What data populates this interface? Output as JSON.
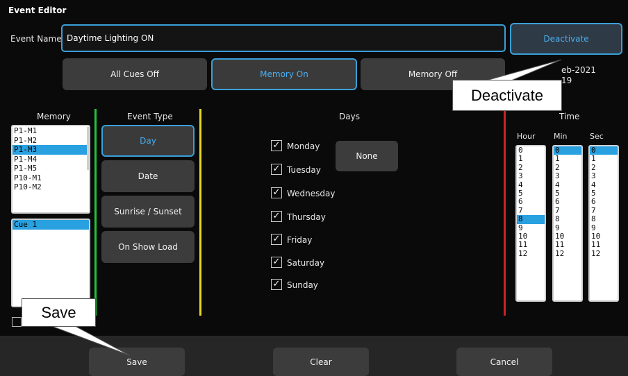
{
  "window": {
    "title": "Event Editor"
  },
  "event_name": {
    "label": "Event Name",
    "value": "Daytime Lighting ON"
  },
  "deactivate_label": "Deactivate",
  "cue_buttons": [
    "All Cues Off",
    "Memory On",
    "Memory Off"
  ],
  "date_partial": {
    "line1": "eb-2021",
    "line2": "19"
  },
  "memory": {
    "header": "Memory",
    "items": [
      "P1-M1",
      "P1-M2",
      "P1-M3",
      "P1-M4",
      "P1-M5",
      "P10-M1",
      "P10-M2"
    ],
    "selected": "P1-M3",
    "cues": [
      "Cue 1"
    ]
  },
  "event_type": {
    "header": "Event Type",
    "options": [
      "Day",
      "Date",
      "Sunrise / Sunset",
      "On Show Load"
    ],
    "selected": "Day"
  },
  "days": {
    "header": "Days",
    "items": [
      "Monday",
      "Tuesday",
      "Wednesday",
      "Thursday",
      "Friday",
      "Saturday",
      "Sunday"
    ],
    "checked_mark": "✓",
    "none_label": "None"
  },
  "time": {
    "header": "Time",
    "hour_label": "Hour",
    "min_label": "Min",
    "sec_label": "Sec",
    "hours": [
      "0",
      "1",
      "2",
      "3",
      "4",
      "5",
      "6",
      "7",
      "8",
      "9",
      "10",
      "11",
      "12"
    ],
    "mins": [
      "0",
      "1",
      "2",
      "3",
      "4",
      "5",
      "6",
      "7",
      "8",
      "9",
      "10",
      "11",
      "12"
    ],
    "secs": [
      "0",
      "1",
      "2",
      "3",
      "4",
      "5",
      "6",
      "7",
      "8",
      "9",
      "10",
      "11",
      "12"
    ],
    "selected_hour": "8",
    "selected_min": "0",
    "selected_sec": "0"
  },
  "footer": {
    "save": "Save",
    "clear": "Clear",
    "cancel": "Cancel"
  },
  "callouts": {
    "deactivate": "Deactivate",
    "save": "Save"
  },
  "colors": {
    "accent": "#3aa0d8",
    "green_divider": "#22c43a",
    "yellow_divider": "#e8d81a",
    "red_divider": "#cc2222"
  }
}
